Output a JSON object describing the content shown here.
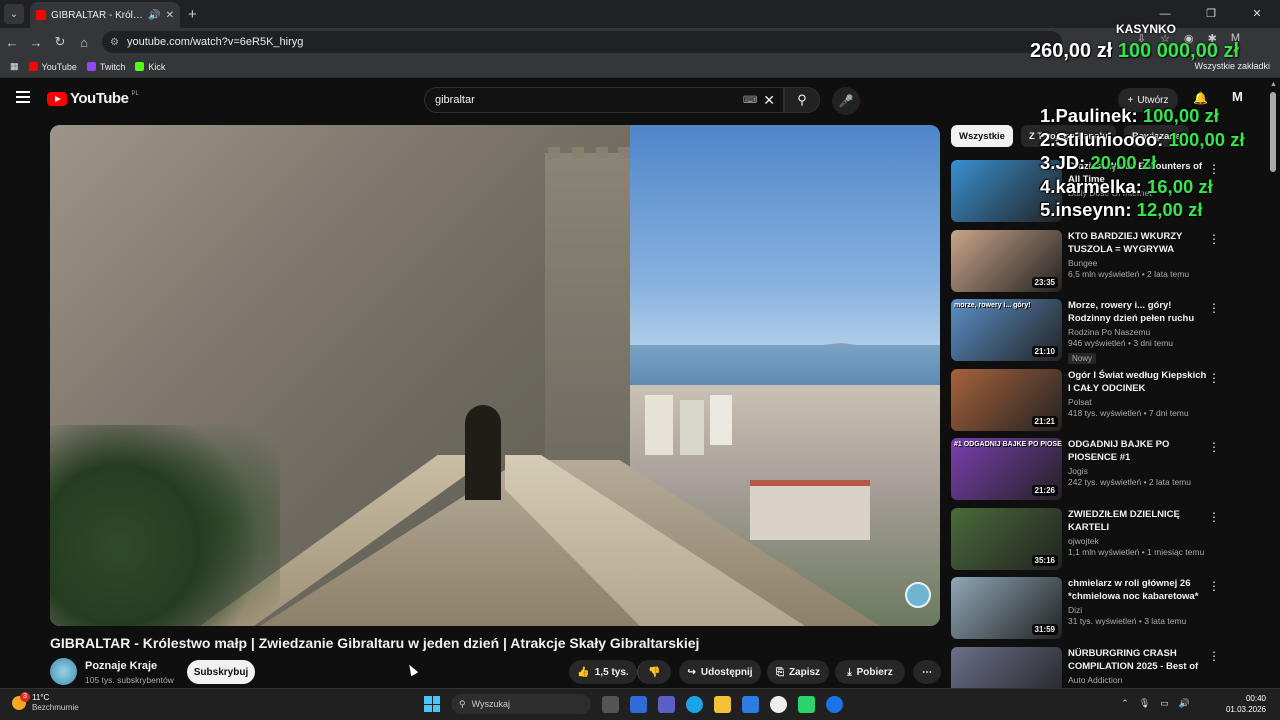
{
  "browser": {
    "tab_title": "GIBRALTAR - Królestwo małp",
    "url": "youtube.com/watch?v=6eR5K_hiryg",
    "bookmarks": [
      {
        "label": "YouTube",
        "color": "#ff0000"
      },
      {
        "label": "Twitch",
        "color": "#9146ff"
      },
      {
        "label": "Kick",
        "color": "#53fc18"
      }
    ],
    "all_bookmarks": "Wszystkie zakładki"
  },
  "overlay": {
    "title": "KASYNKO",
    "balance": "260,00 zł",
    "target": "100 000,00 zł",
    "leaderboard": [
      {
        "rank": "1.",
        "name": "Paulinek:",
        "amount": "100,00 zł"
      },
      {
        "rank": "2.",
        "name": "Stilunioooo:",
        "amount": "100,00 zł"
      },
      {
        "rank": "3.",
        "name": "JD:",
        "amount": "20,00 zł"
      },
      {
        "rank": "4.",
        "name": "karmelka:",
        "amount": "16,00 zł"
      },
      {
        "rank": "5.",
        "name": "inseynn:",
        "amount": "12,00 zł"
      }
    ]
  },
  "youtube": {
    "logo": "YouTube",
    "region": "PL",
    "search_value": "gibraltar",
    "create_label": "Utwórz",
    "video": {
      "title": "GIBRALTAR - Królestwo małp | Zwiedzanie Gibraltaru w jeden dzień | Atrakcje Skały Gibraltarskiej",
      "channel": "Poznaje Kraje",
      "subscribers": "105 tys. subskrybentów",
      "subscribe_label": "Subskrybuj",
      "likes": "1,5 tys.",
      "share_label": "Udostępnij",
      "save_label": "Zapisz",
      "download_label": "Pobierz"
    },
    "chips": [
      "Wszystkie",
      "Z Twojego kanału",
      "Powiązane"
    ],
    "recommendations": [
      {
        "title": "Craziest Whale Encounters of All Time",
        "channel": "Daily Dose Of Internet",
        "meta": "",
        "duration": "",
        "thumb": "#3a8fd1",
        "caption": ""
      },
      {
        "title": "KTO BARDZIEJ WKURZY TUSZOLA = WYGRYWA",
        "channel": "Bungee",
        "meta": "6,5 mln wyświetleń • 2 lata temu",
        "duration": "23:35",
        "thumb": "#c9a58a",
        "caption": ""
      },
      {
        "title": "Morze, rowery i... góry! Rodzinny dzień pełen ruchu na...",
        "channel": "Rodzina Po Naszemu",
        "meta": "946 wyświetleń • 3 dni temu",
        "duration": "21:10",
        "thumb": "#5b8fc7",
        "caption": "morze, rowery i... góry!",
        "badge": "Nowy"
      },
      {
        "title": "Ogór I Świat według Kiepskich I CAŁY ODCINEK",
        "channel": "Polsat",
        "meta": "418 tys. wyświetleń • 7 dni temu",
        "duration": "21:21",
        "thumb": "#a7623c",
        "caption": ""
      },
      {
        "title": "ODGADNIJ BAJKE PO PIOSENCE #1",
        "channel": "Jogis",
        "meta": "242 tys. wyświetleń • 2 lata temu",
        "duration": "21:26",
        "thumb": "#7a3fb0",
        "caption": "#1 ODGADNIJ BAJKE PO PIOSENCE"
      },
      {
        "title": "ZWIEDZIŁEM DZIELNICĘ KARTELI",
        "channel": "ojwojtek",
        "meta": "1,1 mln wyświetleń • 1 miesiąc temu",
        "duration": "35:16",
        "thumb": "#4a6a3a",
        "caption": ""
      },
      {
        "title": "chmielarz w roli głównej 26 *chmielowa noc kabaretowa*",
        "channel": "Dizi",
        "meta": "31 tys. wyświetleń • 3 lata temu",
        "duration": "31:59",
        "thumb": "#8fa7b5",
        "caption": ""
      },
      {
        "title": "NÜRBURGRING CRASH COMPILATION 2025 - Best of ...",
        "channel": "Auto Addiction",
        "meta": "",
        "duration": "",
        "thumb": "#6b6f8a",
        "caption": ""
      }
    ]
  },
  "taskbar": {
    "temp": "11°C",
    "weather": "Bezchmurnie",
    "badge": "3",
    "search_placeholder": "Wyszukaj",
    "time": "00:40",
    "date": "01.03.2026"
  }
}
